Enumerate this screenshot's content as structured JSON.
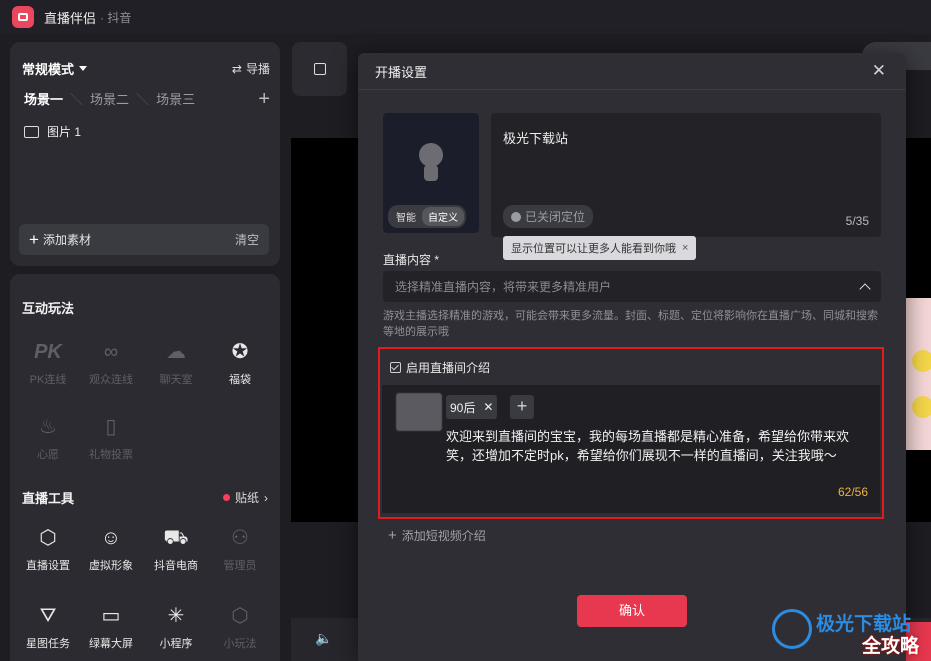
{
  "titlebar": {
    "title": "直播伴侣",
    "subtitle": "· 抖音"
  },
  "sources_panel": {
    "mode": "常规模式",
    "guide": "导播",
    "scenes": [
      "场景一",
      "场景二",
      "场景三"
    ],
    "source_item": "图片 1",
    "add_source": "添加素材",
    "clear": "清空"
  },
  "interact": {
    "title": "互动玩法",
    "items": [
      {
        "label": "PK连线",
        "icon": "PK"
      },
      {
        "label": "观众连线",
        "icon": "∞"
      },
      {
        "label": "聊天室",
        "icon": "☁"
      },
      {
        "label": "福袋",
        "icon": "✪"
      },
      {
        "label": "心愿",
        "icon": "♨"
      },
      {
        "label": "礼物投票",
        "icon": "▯"
      }
    ]
  },
  "tools": {
    "title": "直播工具",
    "sticker": "贴纸",
    "items": [
      {
        "label": "直播设置",
        "icon": "⬡"
      },
      {
        "label": "虚拟形象",
        "icon": "☺"
      },
      {
        "label": "抖音电商",
        "icon": "⛟"
      },
      {
        "label": "管理员",
        "icon": "⚇"
      },
      {
        "label": "星图任务",
        "icon": "⛛"
      },
      {
        "label": "绿幕大屏",
        "icon": "▭"
      },
      {
        "label": "小程序",
        "icon": "✳"
      },
      {
        "label": "小玩法",
        "icon": "⬡"
      }
    ]
  },
  "modal": {
    "title": "开播设置",
    "cover_tabs": [
      "智能",
      "自定义"
    ],
    "stream_title": "极光下载站",
    "location": "已关闭定位",
    "title_count": "5/35",
    "tooltip": "显示位置可以让更多人能看到你哦",
    "content_label": "直播内容 *",
    "content_placeholder": "选择精准直播内容，将带来更多精准用户",
    "content_hint": "游戏主播选择精准的游戏，可能会带来更多流量。封面、标题、定位将影响你在直播广场、同城和搜索等地的展示哦",
    "intro_toggle": "启用直播间介绍",
    "tag": "90后",
    "intro_text": "欢迎来到直播间的宝宝，我的每场直播都是精心准备，希望给你带来欢笑，还增加不定时pk，希望给你们展现不一样的直播间，关注我哦～",
    "intro_count": "62/56",
    "add_video": "添加短视频介绍",
    "confirm": "确认"
  },
  "watermark": {
    "line1": "极光下载站",
    "line2": "全攻略"
  },
  "colors": {
    "accent": "#e8384f",
    "highlight_border": "#e01d1d",
    "count_warning": "#f0b23c"
  }
}
